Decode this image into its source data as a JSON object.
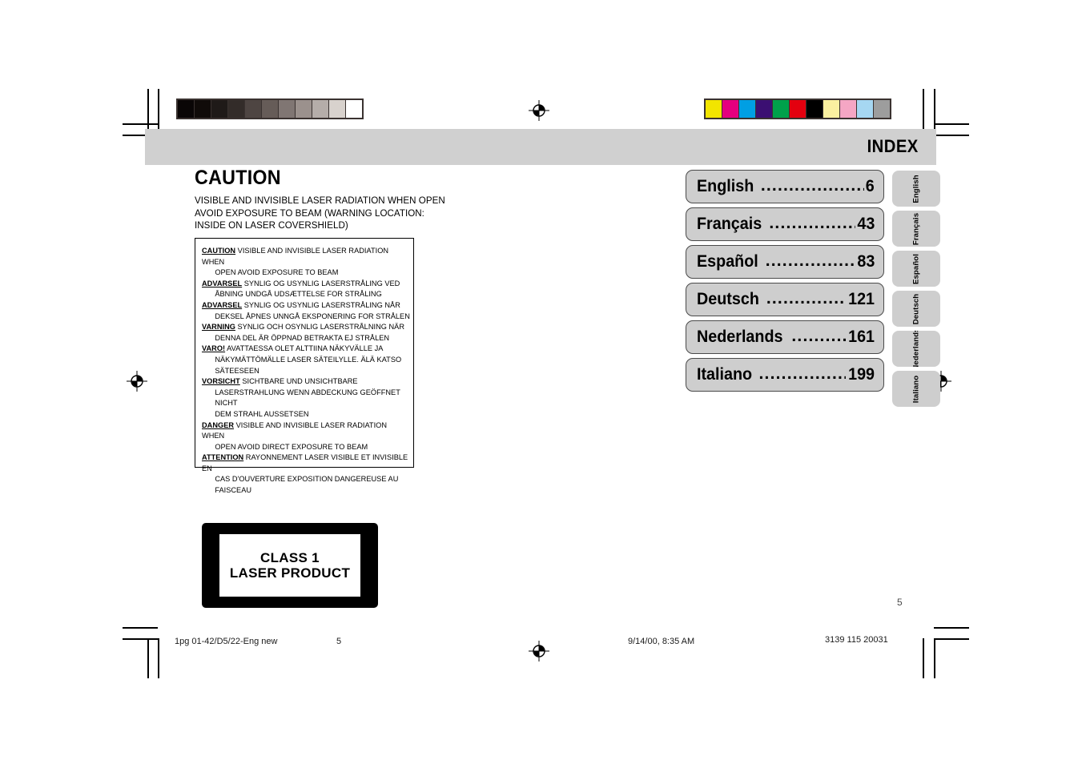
{
  "header": {
    "index_title": "INDEX"
  },
  "caution": {
    "heading": "CAUTION",
    "lines": [
      "VISIBLE AND INVISIBLE LASER RADIATION WHEN OPEN",
      "AVOID EXPOSURE TO BEAM (WARNING LOCATION:",
      "INSIDE ON LASER COVERSHIELD)"
    ]
  },
  "warning_box": {
    "entries": [
      {
        "lead": "CAUTION",
        "first": "VISIBLE AND INVISIBLE LASER RADIATION WHEN",
        "rest": [
          "OPEN AVOID EXPOSURE TO BEAM"
        ]
      },
      {
        "lead": "ADVARSEL",
        "first": "SYNLIG OG USYNLIG LASERSTRÅLING VED",
        "rest": [
          "ÅBNING UNDGÅ UDSÆTTELSE FOR STRÅLING"
        ]
      },
      {
        "lead": "ADVARSEL",
        "first": "SYNLIG OG USYNLIG LASERSTRÅLING NÅR",
        "rest": [
          "DEKSEL ÅPNES UNNGÅ EKSPONERING FOR STRÅLEN"
        ]
      },
      {
        "lead": "VARNING",
        "first": "SYNLIG OCH OSYNLIG LASERSTRÅLNING NÄR",
        "rest": [
          "DENNA DEL ÄR ÖPPNAD BETRAKTA EJ STRÅLEN"
        ]
      },
      {
        "lead": "VARO!",
        "first": "AVATTAESSA OLET ALTTIINA NÄKYVÄLLE JA",
        "rest": [
          "NÄKYMÄTTÖMÄLLE LASER SÄTEILYLLE. ÄLÄ KATSO",
          "SÄTEESEEN"
        ]
      },
      {
        "lead": "VORSICHT",
        "first": "SICHTBARE UND UNSICHTBARE",
        "rest": [
          "LASERSTRAHLUNG WENN ABDECKUNG GEÖFFNET NICHT",
          "DEM STRAHL AUSSETSEN"
        ]
      },
      {
        "lead": "DANGER",
        "first": "VISIBLE AND INVISIBLE LASER RADIATION WHEN",
        "rest": [
          "OPEN AVOID DIRECT EXPOSURE TO BEAM"
        ]
      },
      {
        "lead": "ATTENTION",
        "first": "RAYONNEMENT LASER VISIBLE ET INVISIBLE EN",
        "rest": [
          "CAS D'OUVERTURE EXPOSITION DANGEREUSE AU",
          "FAISCEAU"
        ]
      }
    ]
  },
  "laser_label": {
    "line1": "CLASS 1",
    "line2": "LASER PRODUCT"
  },
  "index": {
    "items": [
      {
        "label": "English",
        "page": "6",
        "dots": "..................................."
      },
      {
        "label": "Français",
        "page": "43",
        "dots": "................................"
      },
      {
        "label": "Español",
        "page": "83",
        "dots": "................................"
      },
      {
        "label": "Deutsch",
        "page": "121",
        "dots": "..............................."
      },
      {
        "label": "Nederlands",
        "page": "161",
        "dots": "........................."
      },
      {
        "label": "Italiano",
        "page": "199",
        "dots": "..............................."
      }
    ]
  },
  "side_tabs": [
    {
      "label": "English"
    },
    {
      "label": "Français"
    },
    {
      "label": "Español"
    },
    {
      "label": "Deutsch"
    },
    {
      "label": "Nederlands"
    },
    {
      "label": "Italiano"
    }
  ],
  "page_number": "5",
  "footer": {
    "file": "1pg 01-42/D5/22-Eng new",
    "page": "5",
    "date": "9/14/00, 8:35 AM",
    "code": "3139 115 20031"
  },
  "calibration": {
    "grayscale": [
      "#0a0606",
      "#100b09",
      "#1f1a18",
      "#332c29",
      "#4e4542",
      "#665c58",
      "#807673",
      "#9b918d",
      "#b5ada9",
      "#d8d2cd",
      "#ffffff"
    ],
    "colors": [
      "#f2e500",
      "#e5007e",
      "#009fe3",
      "#3b0f72",
      "#00a14b",
      "#e3000f",
      "#000000",
      "#faf0a0",
      "#f5a6c4",
      "#a6d7f2",
      "#9d9d9d"
    ]
  }
}
